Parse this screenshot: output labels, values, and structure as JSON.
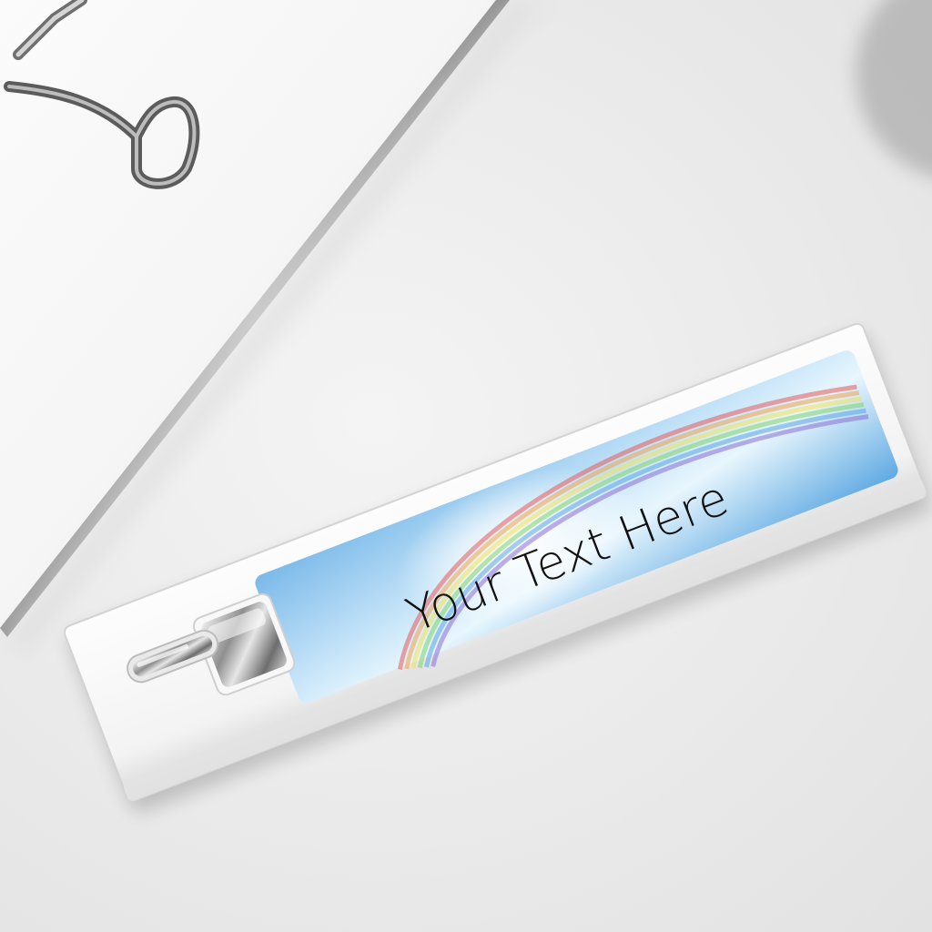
{
  "photo": {
    "subject": "power-bank",
    "label_text": "Your Text Here",
    "colors": {
      "background": "#ececec",
      "device_body": "#f7f7f7",
      "device_edge": "#d8d8d8",
      "label_sky": "#6fb3e8",
      "label_sky_light": "#d9eefb",
      "chrome": "#9a9a9a",
      "text": "#111111"
    }
  }
}
